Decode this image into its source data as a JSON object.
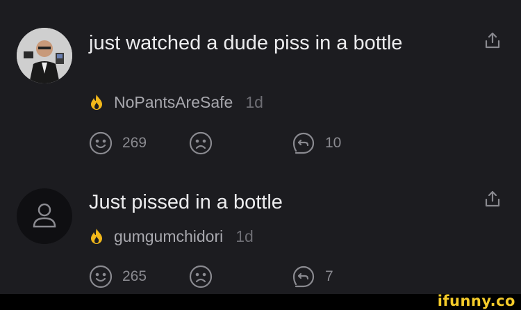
{
  "posts": [
    {
      "title": "just watched a dude piss in a bottle",
      "username": "NoPantsAreSafe",
      "time": "1d",
      "likes": "269",
      "replies": "10",
      "avatar": "photo"
    },
    {
      "title": "Just pissed in a bottle",
      "username": "gumgumchidori",
      "time": "1d",
      "likes": "265",
      "replies": "7",
      "avatar": "default-user-icon"
    }
  ],
  "watermark": "ifunny.co",
  "colors": {
    "background": "#1c1c20",
    "fire": "#f2b81a",
    "watermark": "#f4cb2a"
  }
}
